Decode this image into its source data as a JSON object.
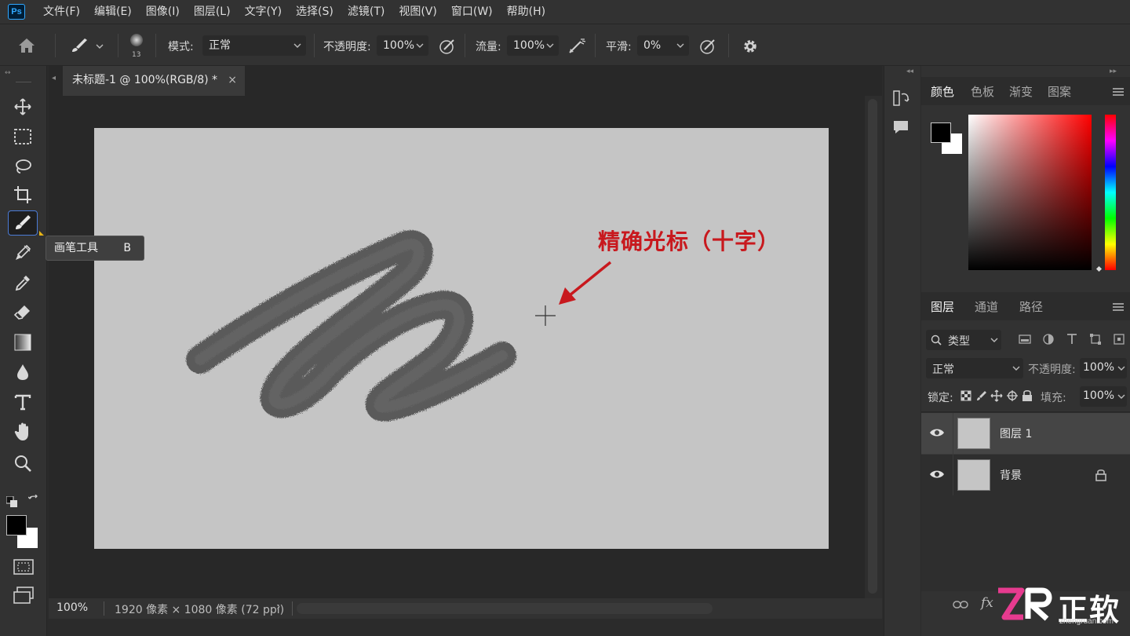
{
  "app": {
    "logo_text": "Ps",
    "accent_color": "#31a8ff"
  },
  "menu": [
    "文件(F)",
    "编辑(E)",
    "图像(I)",
    "图层(L)",
    "文字(Y)",
    "选择(S)",
    "滤镜(T)",
    "视图(V)",
    "窗口(W)",
    "帮助(H)"
  ],
  "options_bar": {
    "brush_size": "13",
    "mode_label": "模式:",
    "mode_value": "正常",
    "opacity_label": "不透明度:",
    "opacity_value": "100%",
    "flow_label": "流量:",
    "flow_value": "100%",
    "smoothing_label": "平滑:",
    "smoothing_value": "0%"
  },
  "document": {
    "tab_title": "未标题-1 @ 100%(RGB/8) *",
    "close_glyph": "×"
  },
  "tooltip": {
    "label": "画笔工具",
    "shortcut": "B"
  },
  "annotation": {
    "text": "精确光标（十字）",
    "color": "#c8191e"
  },
  "status_bar": {
    "zoom": "100%",
    "doc_info": "1920 像素 × 1080 像素 (72 ppi)"
  },
  "color_panel": {
    "tabs": [
      "颜色",
      "色板",
      "渐变",
      "图案"
    ],
    "active_tab": "颜色",
    "foreground": "#000000",
    "background": "#ffffff",
    "hue_color": "#ff0000"
  },
  "layers_panel": {
    "tabs": [
      "图层",
      "通道",
      "路径"
    ],
    "active_tab": "图层",
    "filter_label": "类型",
    "blend_mode": "正常",
    "opacity_label": "不透明度:",
    "opacity_value": "100%",
    "lock_label": "锁定:",
    "fill_label": "填充:",
    "fill_value": "100%",
    "layers": [
      {
        "name": "图层 1",
        "visible": true,
        "locked": false,
        "selected": true
      },
      {
        "name": "背景",
        "visible": true,
        "locked": true,
        "selected": false
      }
    ],
    "footer_fx": "fx"
  },
  "watermark": {
    "logo": "ZR",
    "text": "正软",
    "url": "zhengruan.com"
  }
}
